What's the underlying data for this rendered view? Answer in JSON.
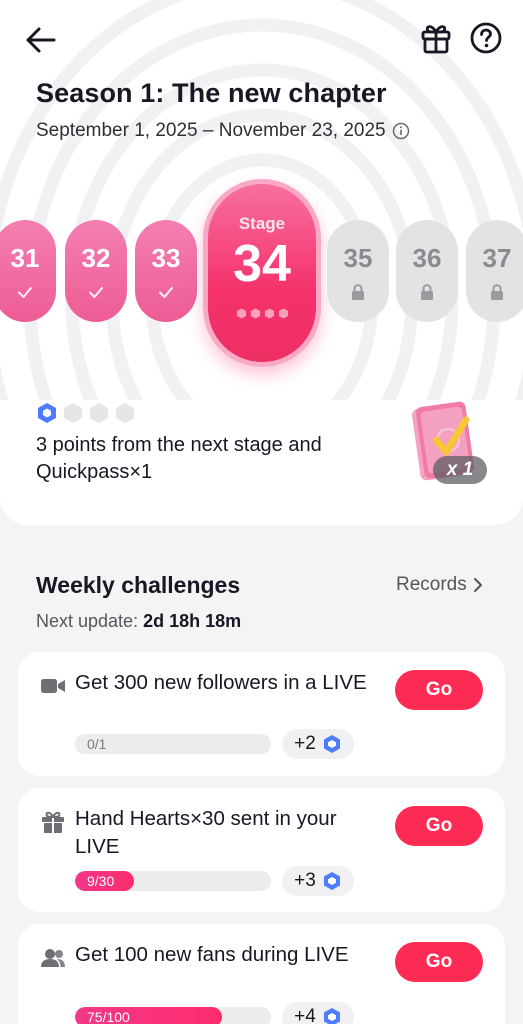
{
  "header": {
    "title": "Season 1: The new chapter",
    "dates": "September 1, 2025 – November 23, 2025"
  },
  "stages": {
    "completed": [
      "31",
      "32",
      "33"
    ],
    "current": {
      "label": "Stage",
      "number": "34",
      "dots_filled": 0,
      "dots_total": 4
    },
    "locked": [
      "35",
      "36",
      "37"
    ]
  },
  "next_stage": {
    "points_filled": 1,
    "points_total": 4,
    "text": "3 points from the next stage and Quickpass×1",
    "quickpass_count": "x 1"
  },
  "weekly": {
    "title": "Weekly challenges",
    "records_label": "Records",
    "next_update_label": "Next update:",
    "next_update_value": "2d 18h 18m"
  },
  "tasks": [
    {
      "icon": "video-camera-icon",
      "text": "Get 300 new followers in a LIVE",
      "progress_text": "0/1",
      "progress": 0.0,
      "reward": "+2",
      "button": "Go"
    },
    {
      "icon": "gift-icon",
      "text": "Hand Hearts×30 sent in your LIVE",
      "progress_text": "9/30",
      "progress": 0.3,
      "reward": "+3",
      "button": "Go"
    },
    {
      "icon": "people-icon",
      "text": "Get 100 new fans during LIVE",
      "progress_text": "75/100",
      "progress": 0.75,
      "reward": "+4",
      "button": "Go"
    }
  ],
  "colors": {
    "accent": "#fe2c55",
    "stage_done": "#ed5c95",
    "stage_current": "#f5326b",
    "stage_locked": "#e3e3e4",
    "point_blue": "#4f7cff"
  }
}
